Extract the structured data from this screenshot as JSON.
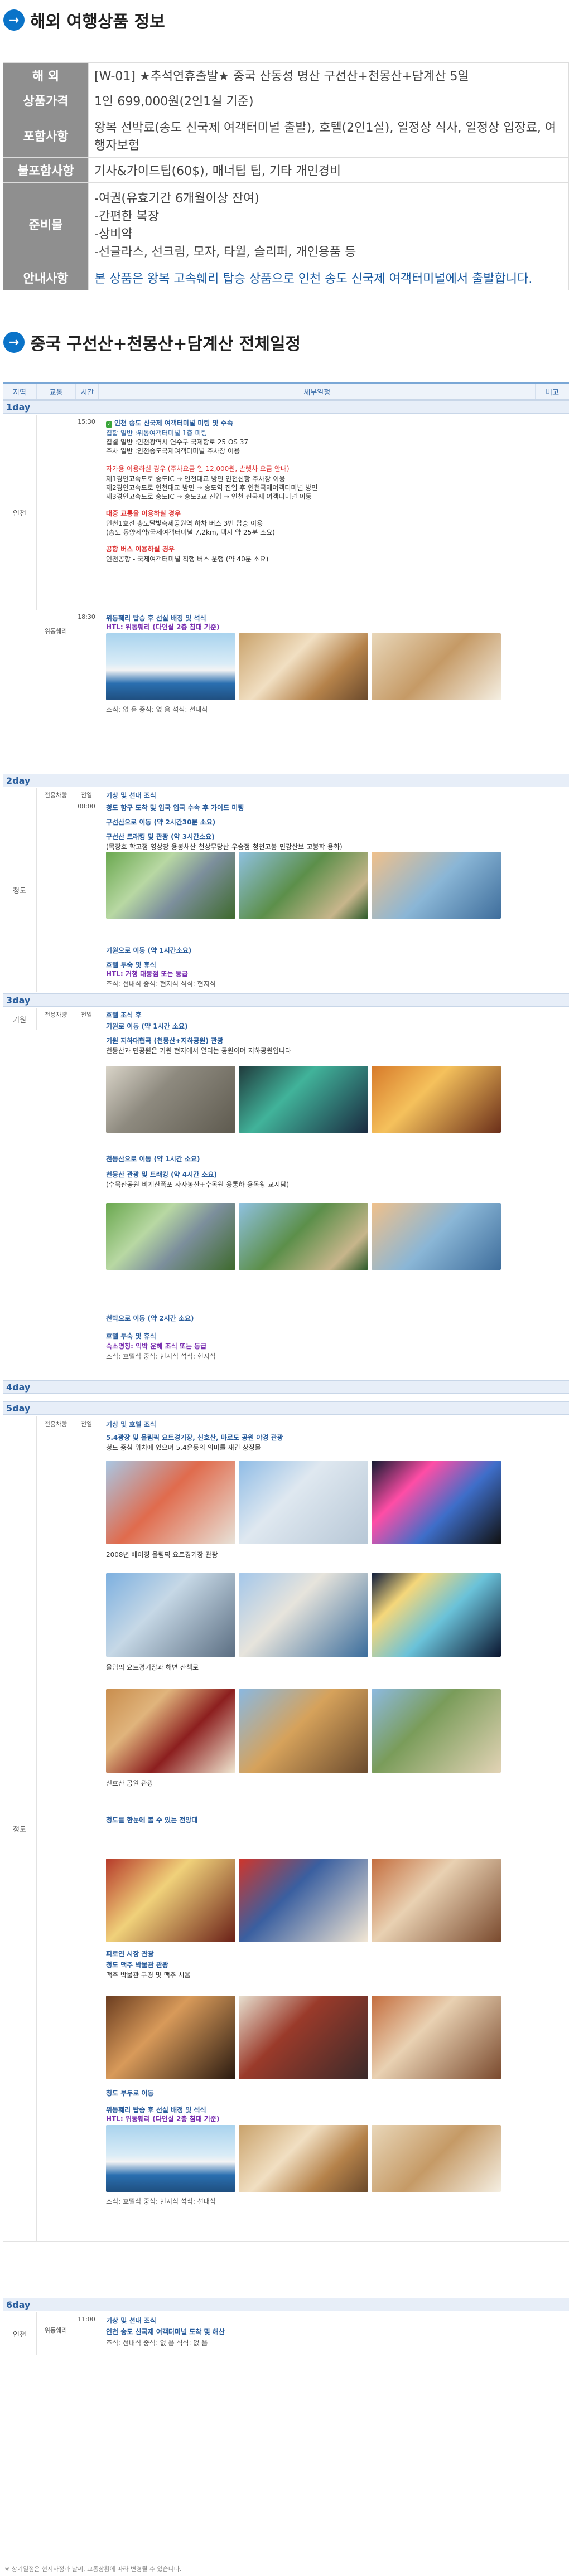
{
  "section1_title": "해외 여행상품 정보",
  "info": [
    {
      "key": "해        외",
      "value": "[W-01] ★추석연휴출발★ 중국 산동성 명산 구선산+천몽산+담계산 5일"
    },
    {
      "key": "상품가격",
      "value": "1인 699,000원(2인1실 기준)"
    },
    {
      "key": "포함사항",
      "value": "왕복 선박료(송도 신국제 여객터미널 출발), 호텔(2인1실), 일정상 식사, 일정상 입장료, 여행자보험"
    },
    {
      "key": "불포함사항",
      "value": "기사&가이드팁(60$), 매너팁 팁, 기타 개인경비"
    },
    {
      "key": "준비물",
      "value_lines": [
        "-여권(유효기간 6개월이상 잔여)",
        "-간편한 복장",
        "-상비약",
        "-선글라스, 선크림, 모자, 타월, 슬리퍼, 개인용품 등"
      ]
    },
    {
      "key": "안내사항",
      "value": "본 상품은 왕복 고속훼리 탑승 상품으로 인천 송도 신국제 여객터미널에서 출발합니다."
    }
  ],
  "section2_title": "중국 구선산+천몽산+담계산 전체일정",
  "schedule_headers": {
    "region": "지역",
    "transport": "교통",
    "time": "시간",
    "detail": "세부일정",
    "note": "비고"
  },
  "days": [
    {
      "label": "1day",
      "region": "인천",
      "ship_region": "위동훼리",
      "time1": "15:30",
      "time2": "18:30",
      "lines": [
        "인천 송도 신국제 여객터미널 미팅 및 수속",
        "집합 일반 :위동여객터미널 1층 미팅",
        "집결 일반 :인천광역시 연수구 국제항로 25 OS 37",
        "주차 일반 :인천송도국제여객터미널 주차장 이용",
        "자가용 이용하실 경우 (주차요금 일 12,000원, 발렛차 요금 안내)",
        "제1경인고속도로 송도IC → 인천대교 방면 인천신항 주차장 이용",
        "제2경인고속도로 인천대교 방면 → 송도역 진입 후 인천국제여객터미널 방면",
        "제3경인고속도로 송도IC → 송도3교 진입 → 인천 신국제 여객터미널 이동",
        "대중 교통을 이용하실 경우",
        "인천1호선 송도달빛축제공원역 하차 버스 3번 탑승 이용",
        "(송도 동양제약/국제여객터미널 7.2km, 택시 약 25분 소요)",
        "공항 버스 이용하실 경우",
        "인천공항 - 국제여객터미널 직행 버스 운행 (약 40분 소요)"
      ],
      "ship_lines": [
        "위동훼리 탑승 후 선실 배정 및 석식",
        "HTL: 위동훼리 (다인실 2층 침대 기준)",
        "조식: 없 음    중식: 없 음    석식: 선내식"
      ]
    },
    {
      "label": "2day",
      "region": "청도",
      "transport": "전용차량",
      "time": "전일",
      "time2": "08:00",
      "lines": [
        "기상 및 선내 조식",
        "청도 항구 도착 및 입국 입국 수속 후 가이드 미팅",
        "구선산으로 이동 (약 2시간30분 소요)",
        "구선산 트래킹 및 관광 (약 3시간소요)",
        "(목장호-학고정-영상창-용봉채산-천상무당산-우승정-청천고봉-민강산보-고봉학-용화)",
        "기원으로 이동 (약 1시간소요)",
        "호텔 투숙 및 휴식",
        "HTL: 거청 대봉점 또는 동급",
        "조식: 선내식    중식: 현지식    석식: 현지식"
      ]
    },
    {
      "label": "3day",
      "region": "기원",
      "transport": "전용차량",
      "time": "전일",
      "lines": [
        "호텔 조식 후",
        "기원로 이동 (약 1시간 소요)",
        "기원 지하대협곡 (천몽산+지하공원) 관광",
        "천몽산과 민공원은 기원 현지에서 열리는 공원이며 지하공원입니다",
        "천몽산으로 이동 (약 1시간 소요)",
        "천몽산 관광 및 트래킹 (약 4시간 소요)",
        "(수묵산공원-비계산폭포-사자봉산+수목원-용통하-용목왕-교시담)",
        "천박으로 이동 (약 2시간 소요)",
        "호텔 투숙 및 휴식",
        "숙소명칭: 익박 운해 조식 또는 동급",
        "조식: 호텔식    중식: 현지식    석식: 현지식"
      ]
    },
    {
      "label": "4day",
      "region": "",
      "lines": []
    },
    {
      "label": "5day",
      "region": "청도",
      "transport": "전용차량",
      "time": "전일",
      "lines": [
        "기상 및 호텔 조식",
        "5.4광장 및 올림픽 요트경기장, 신호산, 마로도 공원 야경 관광",
        "청도 중심 위치에 있으며 5.4운동의 의미를 새긴 상징물",
        "2008년 베이징 올림픽 요트경기장 관광",
        "올림픽 요트경기장과 해변 산책로",
        "신호산 공원 관광",
        "청도를 한눈에 볼 수 있는 전망대",
        "피로연 시장 관광",
        "청도 맥주 박물관 관광",
        "맥주 박물관 구경 및 맥주 시음",
        "청도 부두로 이동",
        "위동훼리 탑승 후 선실 배정 및 석식",
        "HTL: 위동훼리 (다인실 2층 침대 기준)",
        "조식: 호텔식    중식: 현지식    석식: 선내식"
      ]
    },
    {
      "label": "6day",
      "region": "인천",
      "transport": "위동훼리",
      "time": "11:00",
      "lines": [
        "기상 및 선내 조식",
        "인천 송도 신국제 여객터미널 도착 및 해산",
        "조식: 선내식    중식: 없 음    석식: 없 음"
      ]
    }
  ],
  "footnote": "※ 상기일정은 현지사정과 날씨, 교통상황에 따라 변경될 수 있습니다."
}
